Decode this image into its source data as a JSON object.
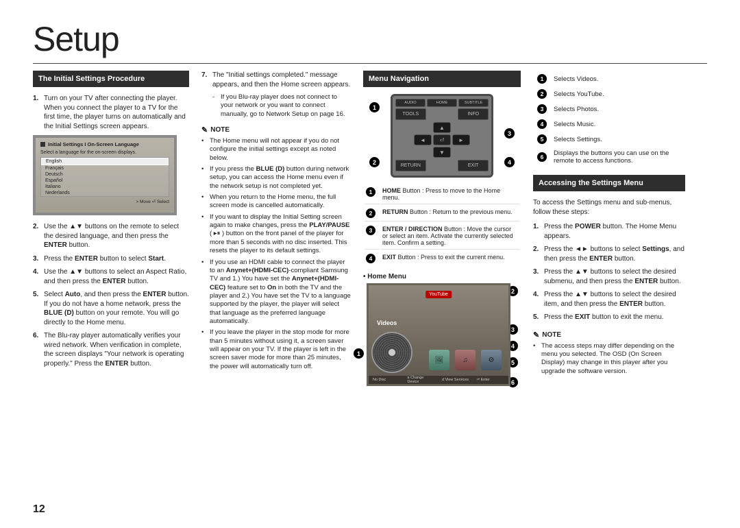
{
  "page_number": "12",
  "title": "Setup",
  "col1": {
    "heading": "The Initial Settings Procedure",
    "steps": [
      {
        "n": "1.",
        "t": "Turn on your TV after connecting the player."
      },
      {
        "n_sub": "",
        "t2": "When you connect the player to a TV for the first time, the player turns on automatically and the Initial Settings screen appears."
      },
      {
        "n": "2.",
        "t": "Use the ▲▼ buttons on the remote to select the desired language, and then press the ",
        "bold": "ENTER",
        "t_after": " button."
      },
      {
        "n": "3.",
        "t": "Press the ",
        "bold": "ENTER",
        "t_after": " button to select ",
        "bold2": "Start",
        "t_after2": "."
      },
      {
        "n": "4.",
        "t": "Use the ▲▼ buttons to select an Aspect Ratio, and then press the ",
        "bold": "ENTER",
        "t_after": " button."
      },
      {
        "n": "5.",
        "t": "Select ",
        "bold": "Auto",
        "t_after": ", and then press the ",
        "bold2": "ENTER",
        "t_after2": " button. If you do not have a home network, press the ",
        "bold3": "BLUE (D)",
        "t_after3": " button on your remote. You will go directly to the Home menu."
      },
      {
        "n": "6.",
        "t": "The Blu-ray player automatically verifies your wired network. When verification in complete, the screen displays \"Your network is operating properly.\" Press the ",
        "bold": "ENTER",
        "t_after": " button."
      }
    ],
    "panel": {
      "title": "Initial Settings I On-Screen Language",
      "sub": "Select a language for the on-screen displays.",
      "langs": [
        "English",
        "Français",
        "Deutsch",
        "Español",
        "Italiano",
        "Nederlands"
      ],
      "foot": "> Move   ⏎ Select"
    }
  },
  "col2": {
    "step7": {
      "n": "7.",
      "t": "The \"Initial settings completed.\" message appears, and then the Home screen appears."
    },
    "sub": "If you Blu-ray player does not connect to your network or you want to connect manually, go to Network Setup on page 16.",
    "note_label": "NOTE",
    "notes": [
      "The Home menu will not appear if you do not configure the initial settings except as noted below.",
      "If you press the BLUE (D) button during network setup, you can access the Home menu even if the network setup is not completed yet.",
      "When you return to the Home menu, the full screen mode is cancelled automatically.",
      "If you want to display the Initial Setting screen again to make changes, press the PLAY/PAUSE ( ▸⏸ ) button on the front panel of the player for more than 5 seconds with no disc inserted. This resets the player to its default settings.",
      "If you use an HDMI cable to connect the player to an Anynet+(HDMI-CEC)-compliant Samsung TV and 1.) You have set the Anynet+(HDMI-CEC) feature set to On in both the TV and the player and 2.) You have set the TV to a language supported by the player, the player will select that language as the preferred language automatically.",
      "If you leave the player in the stop mode for more than 5 minutes without using it, a screen saver will appear on your TV. If the player is left in the screen saver mode for more than 25 minutes, the power will automatically turn off."
    ]
  },
  "col3": {
    "heading": "Menu Navigation",
    "remote_labels": {
      "audio": "AUDIO",
      "home": "HOME",
      "subtitle": "SUBTITLE",
      "tools": "TOOLS",
      "info": "INFO",
      "return": "RETURN",
      "exit": "EXIT"
    },
    "legend": [
      {
        "n": "1",
        "bold": "HOME",
        "text": " Button : Press to move to the Home menu."
      },
      {
        "n": "2",
        "bold": "RETURN",
        "text": " Button : Return to the previous menu."
      },
      {
        "n": "3",
        "bold": "ENTER / DIRECTION",
        "text": " Button : Move the cursor or select an item. Activate the currently selected item. Confirm a setting."
      },
      {
        "n": "4",
        "bold": "EXIT",
        "text": " Button : Press to exit the current menu."
      }
    ],
    "home_menu_label": "• Home Menu",
    "hm": {
      "yt": "YouTube",
      "videos": "Videos",
      "foot": [
        "No Disc",
        "a Change Device",
        "d View Services",
        "⏎ Enter"
      ]
    }
  },
  "col4": {
    "list": [
      {
        "n": "1",
        "t": "Selects Videos."
      },
      {
        "n": "2",
        "t": "Selects YouTube."
      },
      {
        "n": "3",
        "t": "Selects Photos."
      },
      {
        "n": "4",
        "t": "Selects Music."
      },
      {
        "n": "5",
        "t": "Selects Settings."
      },
      {
        "n": "6",
        "t": "Displays the buttons you can use on the remote to access functions."
      }
    ],
    "heading": "Accessing the Settings Menu",
    "intro": "To access the Settings menu and sub-menus, follow these steps:",
    "steps": [
      {
        "n": "1.",
        "t": "Press the ",
        "b": "POWER",
        "t2": " button. The Home Menu appears."
      },
      {
        "n": "2.",
        "t": "Press the ◄► buttons to select ",
        "b": "Settings",
        "t2": ", and then press the ",
        "b2": "ENTER",
        "t3": " button."
      },
      {
        "n": "3.",
        "t": "Press the ▲▼ buttons to select the desired submenu, and then press the ",
        "b": "ENTER",
        "t2": " button."
      },
      {
        "n": "4.",
        "t": "Press the ▲▼ buttons to select the desired item, and then press the ",
        "b": "ENTER",
        "t2": " button."
      },
      {
        "n": "5.",
        "t": "Press the ",
        "b": "EXIT",
        "t2": " button to exit the menu."
      }
    ],
    "note_label": "NOTE",
    "note": "The access steps may differ depending on the menu you selected. The OSD (On Screen Display) may change in this player after you upgrade the software version."
  }
}
